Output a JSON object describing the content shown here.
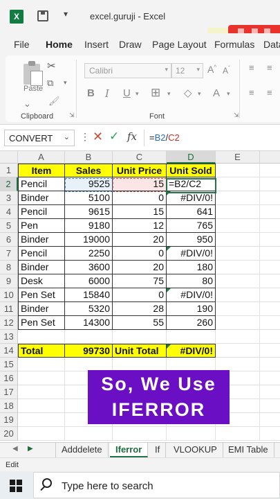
{
  "window": {
    "title": "excel.guruji  -  Excel"
  },
  "ribbon": {
    "tabs": [
      "File",
      "Home",
      "Insert",
      "Draw",
      "Page Layout",
      "Formulas",
      "Data"
    ],
    "active_tab": "Home",
    "clipboard": {
      "paste_label": "Paste",
      "group_label": "Clipboard"
    },
    "font": {
      "font_name": "Calibri",
      "font_size": "12",
      "group_label": "Font"
    }
  },
  "formula_bar": {
    "name_box": "CONVERT",
    "formula_prefix": "=",
    "formula_ref1": "B2",
    "formula_slash": "/",
    "formula_ref2": "C2"
  },
  "grid": {
    "columns": [
      "A",
      "B",
      "C",
      "D",
      "E"
    ],
    "active_column": "D",
    "active_row": "2",
    "row_numbers": [
      "1",
      "2",
      "3",
      "4",
      "5",
      "6",
      "7",
      "8",
      "9",
      "10",
      "11",
      "12",
      "13",
      "14",
      "15",
      "16",
      "17",
      "18",
      "19",
      "20"
    ],
    "headers": [
      "Item",
      "Sales",
      "Unit Price",
      "Unit Sold"
    ],
    "rows": [
      [
        "Pencil",
        "9525",
        "15",
        "=B2/C2"
      ],
      [
        "Binder",
        "5100",
        "0",
        "#DIV/0!"
      ],
      [
        "Pencil",
        "9615",
        "15",
        "641"
      ],
      [
        "Pen",
        "9180",
        "12",
        "765"
      ],
      [
        "Binder",
        "19000",
        "20",
        "950"
      ],
      [
        "Pencil",
        "2250",
        "0",
        "#DIV/0!"
      ],
      [
        "Binder",
        "3600",
        "20",
        "180"
      ],
      [
        "Desk",
        "6000",
        "75",
        "80"
      ],
      [
        "Pen Set",
        "15840",
        "0",
        "#DIV/0!"
      ],
      [
        "Binder",
        "5320",
        "28",
        "190"
      ],
      [
        "Pen Set",
        "14300",
        "55",
        "260"
      ]
    ],
    "total_row": [
      "Total",
      "99730",
      "Unit Total",
      "#DIV/0!"
    ]
  },
  "banner": {
    "line1": "So, We Use",
    "line2": "IFERROR"
  },
  "sheet_tabs": [
    "Adddelete",
    "Iferror",
    "If",
    "VLOOKUP",
    "EMI Table"
  ],
  "active_sheet": "Iferror",
  "status": {
    "mode": "Edit"
  },
  "taskbar": {
    "search_placeholder": "Type here to search"
  },
  "colors": {
    "excel_green": "#217346",
    "highlight_yellow": "#ffff00",
    "banner_purple": "#6a0fc4"
  }
}
